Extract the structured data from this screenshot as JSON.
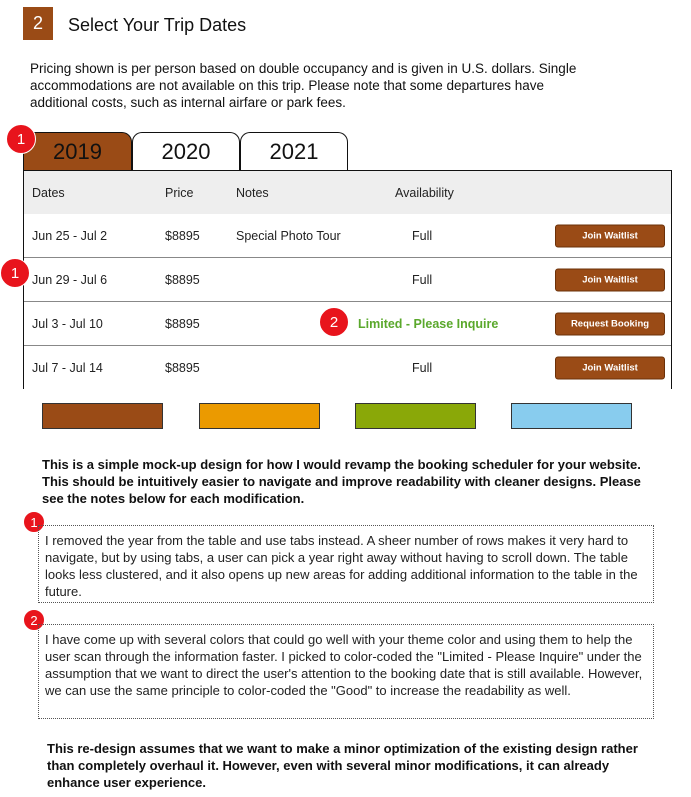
{
  "header": {
    "step_number": "2",
    "title": "Select Your Trip Dates",
    "intro": "Pricing shown is per person based on double occupancy and is given in U.S. dollars. Single accommodations are not available on this trip. Please note that some departures have additional costs, such as internal airfare or park fees."
  },
  "tabs": [
    {
      "label": "2019",
      "active": true
    },
    {
      "label": "2020",
      "active": false
    },
    {
      "label": "2021",
      "active": false
    }
  ],
  "markers": {
    "tab_marker": "1",
    "row_marker": "1",
    "limited_marker": "2",
    "note1_marker": "1",
    "note2_marker": "2"
  },
  "table": {
    "columns": [
      "Dates",
      "Price",
      "Notes",
      "Availability"
    ],
    "rows": [
      {
        "dates": "Jun 25 - Jul 2",
        "price": "$8895",
        "notes": "Special Photo Tour",
        "availability": "Full",
        "action": "Join Waitlist"
      },
      {
        "dates": "Jun 29 - Jul 6",
        "price": "$8895",
        "notes": "",
        "availability": "Full",
        "action": "Join Waitlist"
      },
      {
        "dates": "Jul 3 - Jul 10",
        "price": "$8895",
        "notes": "",
        "availability": "Limited - Please Inquire",
        "action": "Request Booking"
      },
      {
        "dates": "Jul 7 - Jul 14",
        "price": "$8895",
        "notes": "",
        "availability": "Full",
        "action": "Join Waitlist"
      }
    ]
  },
  "palette": [
    "#9a4b16",
    "#eb9a00",
    "#8aa808",
    "#88ccee"
  ],
  "colors": {
    "accent": "#9a4b16",
    "limited_text": "#5aa82c",
    "marker": "#e8141c"
  },
  "notes": {
    "summary": "This is a simple mock-up design for how I would revamp the booking scheduler for your website. This should be intuitively easier to navigate and improve readability with cleaner designs. Please see the notes below for each modification.",
    "note1": "I removed the year from the table and use tabs instead. A sheer number of rows makes it very hard to navigate, but by using tabs, a user can pick a year right away without having to scroll down. The table looks less clustered, and it also opens up new areas for adding additional information to the table in the future.",
    "note2": "I have come up with several colors that could go well with your theme color and using them to help the user scan through the information faster. I picked to color-coded the \"Limited - Please Inquire\" under the assumption that we want to direct the user's attention to the booking date that is still available. However, we can use the same principle to color-coded the \"Good\" to increase the readability as well.",
    "conclusion": "This re-design assumes that we want to make a minor optimization of the existing design rather than completely overhaul it. However, even with several minor modifications, it can already enhance user experience."
  }
}
